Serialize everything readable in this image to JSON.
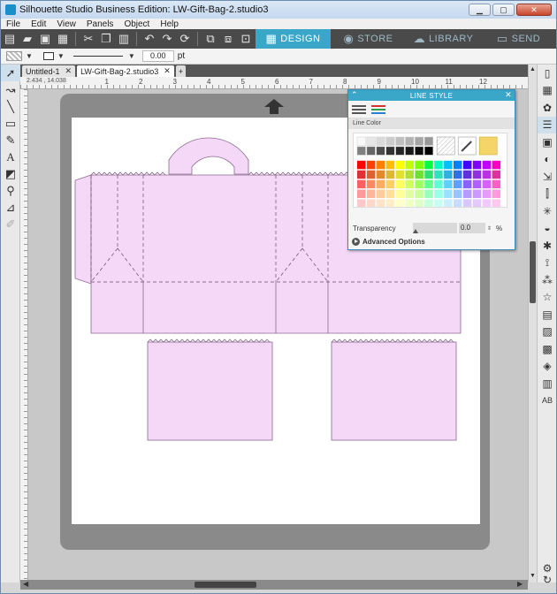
{
  "window": {
    "title": "Silhouette Studio Business Edition: LW-Gift-Bag-2.studio3",
    "min": "▁",
    "max": "▢",
    "close": "✕"
  },
  "menu": [
    "File",
    "Edit",
    "View",
    "Panels",
    "Object",
    "Help"
  ],
  "toolbar": {
    "icons": [
      "new-doc-icon",
      "open-folder-icon",
      "save-icon",
      "print-icon",
      "cut-icon",
      "copy-icon",
      "paste-icon",
      "undo-icon",
      "redo-icon",
      "redraw-icon",
      "group-icon",
      "ungroup-icon",
      "compound-path-icon"
    ],
    "nav_tabs": [
      {
        "label": "DESIGN",
        "active": true
      },
      {
        "label": "STORE",
        "active": false
      },
      {
        "label": "LIBRARY",
        "active": false
      },
      {
        "label": "SEND",
        "active": false
      }
    ]
  },
  "options_bar": {
    "line_weight": "0.00",
    "unit": "pt"
  },
  "doc_tabs": [
    {
      "label": "Untitled-1",
      "active": false
    },
    {
      "label": "LW-Gift-Bag-2.studio3",
      "active": true
    }
  ],
  "ruler": {
    "coords": "2.434 , 14.038",
    "numbers": [
      "1",
      "2",
      "3",
      "4",
      "5",
      "6",
      "7",
      "8",
      "9",
      "10",
      "11",
      "12"
    ]
  },
  "line_style_panel": {
    "title": "LINE STYLE",
    "section": "Line Color",
    "transparency_label": "Transparency",
    "transparency_value": "0.0",
    "transparency_unit": "%",
    "transparency_fraction": 0,
    "advanced": "Advanced Options",
    "selected_color": "#f5d46a",
    "grays": [
      "#f8f8f8",
      "#e6e6e6",
      "#d9d9d9",
      "#cccccc",
      "#bfbfbf",
      "#b3b3b3",
      "#a6a6a6",
      "#999999",
      "#808080",
      "#666666",
      "#4d4d4d",
      "#333333",
      "#262626",
      "#1a1a1a",
      "#0d0d0d",
      "#000000"
    ],
    "colors": [
      [
        "#ff0000",
        "#ff4000",
        "#ff8000",
        "#ffbf00",
        "#ffff00",
        "#bfff00",
        "#80ff00",
        "#00ff40",
        "#00ffbf",
        "#00bfff",
        "#0080ff",
        "#4000ff",
        "#8000ff",
        "#bf00ff",
        "#ff00bf"
      ],
      [
        "#e03030",
        "#e06030",
        "#e08a30",
        "#e0b830",
        "#e0e030",
        "#b0e030",
        "#70e030",
        "#30e070",
        "#30e0c0",
        "#30b0e0",
        "#3070e0",
        "#6030e0",
        "#9030e0",
        "#c030e0",
        "#e030a0"
      ],
      [
        "#ff6060",
        "#ff8a60",
        "#ffae60",
        "#ffd060",
        "#ffff60",
        "#d0ff60",
        "#a0ff60",
        "#60ff90",
        "#60ffd8",
        "#60d0ff",
        "#60a0ff",
        "#8a60ff",
        "#b060ff",
        "#d860ff",
        "#ff60c8"
      ],
      [
        "#ff9a9a",
        "#ffb59a",
        "#ffcc9a",
        "#ffe09a",
        "#ffff9a",
        "#e0ff9a",
        "#c8ff9a",
        "#9affbd",
        "#9affe6",
        "#9ae0ff",
        "#9ac4ff",
        "#b59aff",
        "#cc9aff",
        "#e69aff",
        "#ff9ae0"
      ],
      [
        "#ffc8c8",
        "#ffd6c8",
        "#ffe3c8",
        "#ffeec8",
        "#ffffc8",
        "#eeffc8",
        "#e0ffc8",
        "#c8ffdc",
        "#c8fff2",
        "#c8eeff",
        "#c8dcff",
        "#d6c8ff",
        "#e3c8ff",
        "#f2c8ff",
        "#ffc8ee"
      ]
    ]
  },
  "design": {
    "fill": "#f5d8f7",
    "stroke": "#8a6a8c"
  },
  "left_tools": [
    "select-tool-icon",
    "node-edit-icon",
    "line-tool-icon",
    "rectangle-tool-icon",
    "pencil-tool-icon",
    "text-tool-icon",
    "eraser-tool-icon",
    "knife-tool-icon",
    "eyedropper-tool-icon",
    "pixscan-tool-icon"
  ],
  "right_tools": [
    "page-setup-icon",
    "grid-icon",
    "fill-color-icon",
    "line-style-icon",
    "fill-gradient-icon",
    "offset-icon",
    "transform-icon",
    "align-icon",
    "replicate-icon",
    "modify-icon",
    "knife-icon",
    "trace-icon",
    "rhinestone-icon",
    "star-icon",
    "layers-icon",
    "sketch-icon",
    "library-icon",
    "pixscan-icon",
    "print-cut-icon",
    "text-style-icon",
    "settings-icon",
    "send-icon"
  ]
}
